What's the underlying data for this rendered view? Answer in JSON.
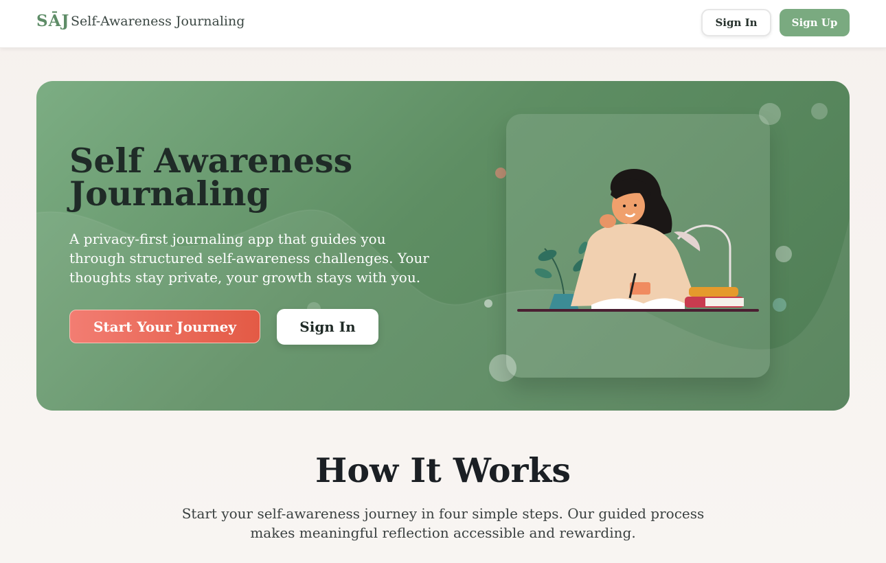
{
  "header": {
    "logo": "SĀJ",
    "app_name": "Self-Awareness Journaling",
    "sign_in_label": "Sign In",
    "sign_up_label": "Sign Up"
  },
  "hero": {
    "title": "Self Awareness Journaling",
    "description": "A privacy-first journaling app that guides you through structured self-awareness challenges. Your thoughts stay private, your growth stays with you.",
    "start_label": "Start Your Journey",
    "sign_in_label": "Sign In",
    "illustration": "woman-writing-journal-illustration"
  },
  "how_it_works": {
    "title": "How It Works",
    "description": "Start your self-awareness journey in four simple steps. Our guided process makes meaningful reflection accessible and rewarding."
  },
  "colors": {
    "brand_green": "#7aaa80",
    "hero_green": "#5e8e63",
    "accent_coral": "#e35a45"
  }
}
